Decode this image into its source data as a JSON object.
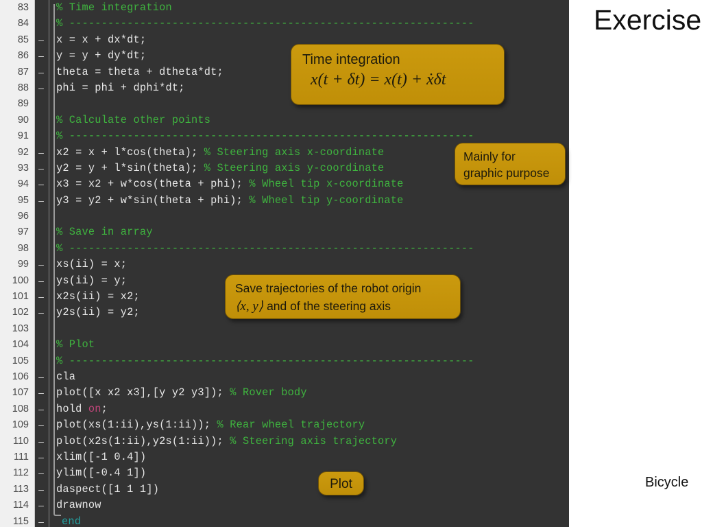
{
  "slide": {
    "title": "Exercise",
    "footer": "Bicycle"
  },
  "editor": {
    "name": "matlab-editor",
    "colors": {
      "background": "#333333",
      "gutter": "#f0f0f0",
      "text": "#e8e8e8",
      "comment": "#3fb43f",
      "keyword": "#c0457a",
      "keyword2": "#23a0a0",
      "callout": "#c8960c"
    },
    "lines": [
      {
        "num": "83",
        "fold": "",
        "segments": [
          {
            "t": "% Time integration",
            "c": "cm"
          }
        ]
      },
      {
        "num": "84",
        "fold": "",
        "segments": [
          {
            "t": "% ---------------------------------------------------------------",
            "c": "cm"
          }
        ]
      },
      {
        "num": "85",
        "fold": "–",
        "segments": [
          {
            "t": "x = x + dx*dt;",
            "c": ""
          }
        ]
      },
      {
        "num": "86",
        "fold": "–",
        "segments": [
          {
            "t": "y = y + dy*dt;",
            "c": ""
          }
        ]
      },
      {
        "num": "87",
        "fold": "–",
        "segments": [
          {
            "t": "theta = theta + dtheta*dt;",
            "c": ""
          }
        ]
      },
      {
        "num": "88",
        "fold": "–",
        "segments": [
          {
            "t": "phi = phi + dphi*dt;",
            "c": ""
          }
        ]
      },
      {
        "num": "89",
        "fold": "",
        "segments": [
          {
            "t": "",
            "c": ""
          }
        ]
      },
      {
        "num": "90",
        "fold": "",
        "segments": [
          {
            "t": "% Calculate other points",
            "c": "cm"
          }
        ]
      },
      {
        "num": "91",
        "fold": "",
        "segments": [
          {
            "t": "% ---------------------------------------------------------------",
            "c": "cm"
          }
        ]
      },
      {
        "num": "92",
        "fold": "–",
        "segments": [
          {
            "t": "x2 = x + l*cos(theta); ",
            "c": ""
          },
          {
            "t": "% Steering axis x-coordinate",
            "c": "cm"
          }
        ]
      },
      {
        "num": "93",
        "fold": "–",
        "segments": [
          {
            "t": "y2 = y + l*sin(theta); ",
            "c": ""
          },
          {
            "t": "% Steering axis y-coordinate",
            "c": "cm"
          }
        ]
      },
      {
        "num": "94",
        "fold": "–",
        "segments": [
          {
            "t": "x3 = x2 + w*cos(theta + phi); ",
            "c": ""
          },
          {
            "t": "% Wheel tip x-coordinate",
            "c": "cm"
          }
        ]
      },
      {
        "num": "95",
        "fold": "–",
        "segments": [
          {
            "t": "y3 = y2 + w*sin(theta + phi); ",
            "c": ""
          },
          {
            "t": "% Wheel tip y-coordinate",
            "c": "cm"
          }
        ]
      },
      {
        "num": "96",
        "fold": "",
        "segments": [
          {
            "t": "",
            "c": ""
          }
        ]
      },
      {
        "num": "97",
        "fold": "",
        "segments": [
          {
            "t": "% Save in array",
            "c": "cm"
          }
        ]
      },
      {
        "num": "98",
        "fold": "",
        "segments": [
          {
            "t": "% ---------------------------------------------------------------",
            "c": "cm"
          }
        ]
      },
      {
        "num": "99",
        "fold": "–",
        "segments": [
          {
            "t": "xs(ii) = x;",
            "c": ""
          }
        ]
      },
      {
        "num": "100",
        "fold": "–",
        "segments": [
          {
            "t": "ys(ii) = y;",
            "c": ""
          }
        ]
      },
      {
        "num": "101",
        "fold": "–",
        "segments": [
          {
            "t": "x2s(ii) = x2;",
            "c": ""
          }
        ]
      },
      {
        "num": "102",
        "fold": "–",
        "segments": [
          {
            "t": "y2s(ii) = y2;",
            "c": ""
          }
        ]
      },
      {
        "num": "103",
        "fold": "",
        "segments": [
          {
            "t": "",
            "c": ""
          }
        ]
      },
      {
        "num": "104",
        "fold": "",
        "segments": [
          {
            "t": "% Plot",
            "c": "cm"
          }
        ]
      },
      {
        "num": "105",
        "fold": "",
        "segments": [
          {
            "t": "% ---------------------------------------------------------------",
            "c": "cm"
          }
        ]
      },
      {
        "num": "106",
        "fold": "–",
        "segments": [
          {
            "t": "cla",
            "c": ""
          }
        ]
      },
      {
        "num": "107",
        "fold": "–",
        "segments": [
          {
            "t": "plot([x x2 x3],[y y2 y3]); ",
            "c": ""
          },
          {
            "t": "% Rover body",
            "c": "cm"
          }
        ]
      },
      {
        "num": "108",
        "fold": "–",
        "segments": [
          {
            "t": "hold ",
            "c": ""
          },
          {
            "t": "on",
            "c": "kw"
          },
          {
            "t": ";",
            "c": ""
          }
        ]
      },
      {
        "num": "109",
        "fold": "–",
        "segments": [
          {
            "t": "plot(xs(1:ii),ys(1:ii)); ",
            "c": ""
          },
          {
            "t": "% Rear wheel trajectory",
            "c": "cm"
          }
        ]
      },
      {
        "num": "110",
        "fold": "–",
        "segments": [
          {
            "t": "plot(x2s(1:ii),y2s(1:ii)); ",
            "c": ""
          },
          {
            "t": "% Steering axis trajectory",
            "c": "cm"
          }
        ]
      },
      {
        "num": "111",
        "fold": "–",
        "segments": [
          {
            "t": "xlim([-1 0.4])",
            "c": ""
          }
        ]
      },
      {
        "num": "112",
        "fold": "–",
        "segments": [
          {
            "t": "ylim([-0.4 1])",
            "c": ""
          }
        ]
      },
      {
        "num": "113",
        "fold": "–",
        "segments": [
          {
            "t": "daspect([1 1 1])",
            "c": ""
          }
        ]
      },
      {
        "num": "114",
        "fold": "–",
        "segments": [
          {
            "t": "drawnow",
            "c": ""
          }
        ]
      },
      {
        "num": "115",
        "fold": "–",
        "segments": [
          {
            "t": "end",
            "c": "kw2"
          }
        ],
        "dedent": true
      }
    ]
  },
  "callouts": {
    "time_integration": {
      "label": "Time integration",
      "formula": "x(t + δt) = x(t) + ẋδt"
    },
    "graphic_purpose": {
      "line1": "Mainly for",
      "line2": "graphic purpose"
    },
    "save_trajectories": {
      "line1": "Save trajectories of the robot origin",
      "line2_math": "⟨x, y⟩",
      "line2_rest": " and of the steering axis"
    },
    "plot": {
      "label": "Plot"
    }
  }
}
